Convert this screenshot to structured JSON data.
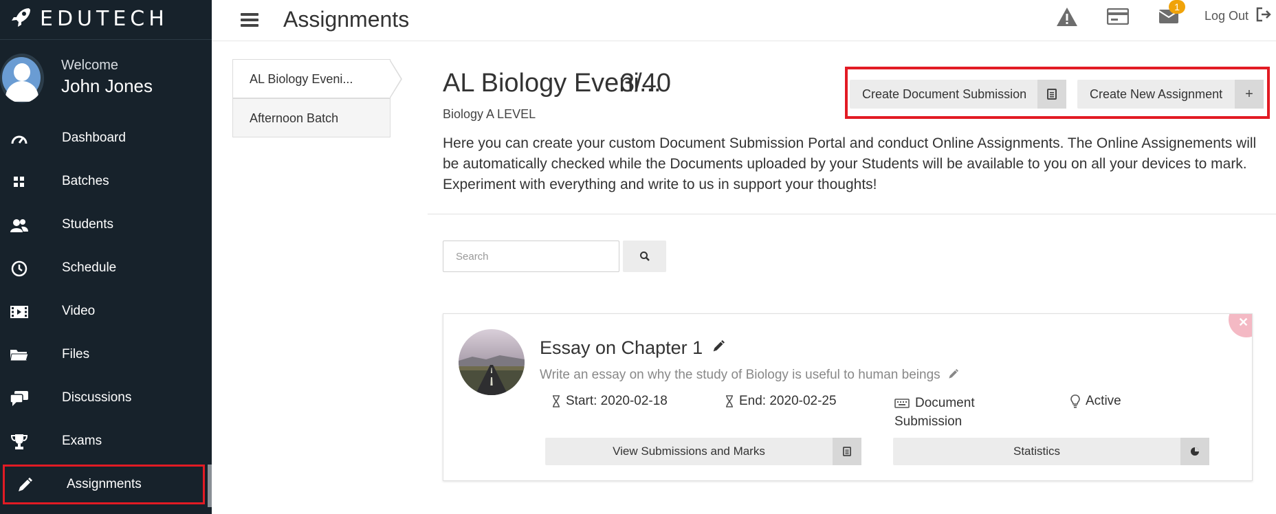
{
  "brand": {
    "name": "EDUTECH"
  },
  "profile": {
    "welcome": "Welcome",
    "name": "John Jones"
  },
  "nav": [
    {
      "label": "Dashboard",
      "icon": "gauge-icon"
    },
    {
      "label": "Batches",
      "icon": "grid-icon"
    },
    {
      "label": "Students",
      "icon": "users-icon"
    },
    {
      "label": "Schedule",
      "icon": "clock-icon"
    },
    {
      "label": "Video",
      "icon": "film-icon"
    },
    {
      "label": "Files",
      "icon": "folder-icon"
    },
    {
      "label": "Discussions",
      "icon": "comments-icon"
    },
    {
      "label": "Exams",
      "icon": "trophy-icon"
    },
    {
      "label": "Assignments",
      "icon": "pencil-icon",
      "active": true
    }
  ],
  "topbar": {
    "title": "Assignments",
    "notification_count": "1",
    "logout": "Log Out"
  },
  "batches": [
    {
      "label": "AL Biology Eveni...",
      "selected": true
    },
    {
      "label": "Afternoon Batch"
    }
  ],
  "main": {
    "batch_title": "AL Biology Eveni...",
    "batch_count": "3/40",
    "batch_subject": "Biology A LEVEL",
    "description": "Here you can create your custom Document Submission Portal and conduct Online Assignments. The Online Assignements will be automatically checked while the Documents uploaded by your Students will be available to you on all your devices to mark. Experiment with everything and write to us in support your thoughts!",
    "create_doc_label": "Create Document Submission",
    "create_assign_label": "Create New Assignment",
    "create_assign_addon": "+"
  },
  "search": {
    "placeholder": "Search"
  },
  "assignment": {
    "title": "Essay on Chapter 1",
    "description": "Write an essay on why the study of Biology is useful to human beings",
    "start": "Start: 2020-02-18",
    "end": "End: 2020-02-25",
    "type": "Document Submission",
    "status": "Active",
    "view_label": "View Submissions and Marks",
    "stats_label": "Statistics"
  },
  "colors": {
    "sidebar_bg": "#17222b",
    "highlight": "#e21b24",
    "badge": "#f0a30a"
  }
}
